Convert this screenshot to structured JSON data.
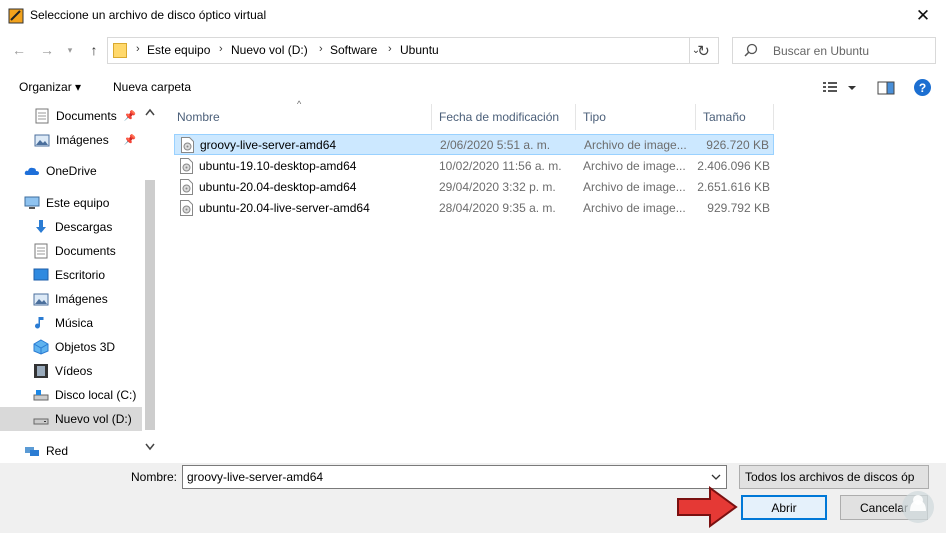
{
  "window": {
    "title": "Seleccione un archivo de disco óptico virtual",
    "close_glyph": "✕"
  },
  "nav_buttons": {
    "back": "←",
    "forward": "→",
    "recent": "▾",
    "up": "↑"
  },
  "address": {
    "crumbs": [
      "Este equipo",
      "Nuevo vol (D:)",
      "Software",
      "Ubuntu"
    ],
    "separator": "›",
    "dropdown": "⌄",
    "refresh": "↻"
  },
  "search": {
    "placeholder": "Buscar en Ubuntu"
  },
  "toolbar": {
    "organize": "Organizar ▾",
    "new_folder": "Nueva carpeta",
    "help": "?"
  },
  "sidebar": {
    "items": [
      {
        "label": "Documents",
        "icon": "documents-icon",
        "pinned": true
      },
      {
        "label": "Imágenes",
        "icon": "pictures-icon",
        "pinned": true
      },
      {
        "label": "OneDrive",
        "icon": "onedrive-icon"
      },
      {
        "label": "Este equipo",
        "icon": "computer-icon"
      },
      {
        "label": "Descargas",
        "icon": "downloads-icon"
      },
      {
        "label": "Documents",
        "icon": "documents-icon"
      },
      {
        "label": "Escritorio",
        "icon": "desktop-icon"
      },
      {
        "label": "Imágenes",
        "icon": "pictures-icon"
      },
      {
        "label": "Música",
        "icon": "music-icon"
      },
      {
        "label": "Objetos 3D",
        "icon": "objects-3d-icon"
      },
      {
        "label": "Vídeos",
        "icon": "videos-icon"
      },
      {
        "label": "Disco local (C:)",
        "icon": "drive-icon"
      },
      {
        "label": "Nuevo vol (D:)",
        "icon": "drive-icon",
        "selected": true
      },
      {
        "label": "Red",
        "icon": "network-icon"
      }
    ],
    "pin_glyph": "📌"
  },
  "columns": {
    "name": "Nombre",
    "date": "Fecha de modificación",
    "type": "Tipo",
    "size": "Tamaño"
  },
  "files": [
    {
      "name": "groovy-live-server-amd64",
      "date": "2/06/2020 5:51 a. m.",
      "type": "Archivo de image...",
      "size": "926.720 KB",
      "selected": true
    },
    {
      "name": "ubuntu-19.10-desktop-amd64",
      "date": "10/02/2020 11:56 a. m.",
      "type": "Archivo de image...",
      "size": "2.406.096 KB"
    },
    {
      "name": "ubuntu-20.04-desktop-amd64",
      "date": "29/04/2020 3:32 p. m.",
      "type": "Archivo de image...",
      "size": "2.651.616 KB"
    },
    {
      "name": "ubuntu-20.04-live-server-amd64",
      "date": "28/04/2020 9:35 a. m.",
      "type": "Archivo de image...",
      "size": "929.792 KB"
    }
  ],
  "bottom": {
    "filename_label": "Nombre:",
    "filename_value": "groovy-live-server-amd64",
    "filetype_value": "Todos los archivos de discos óp",
    "open": "Abrir",
    "cancel": "Cancelar"
  },
  "colors": {
    "accent": "#0078d7",
    "selection": "#cce8ff",
    "arrow": "#e53935"
  }
}
